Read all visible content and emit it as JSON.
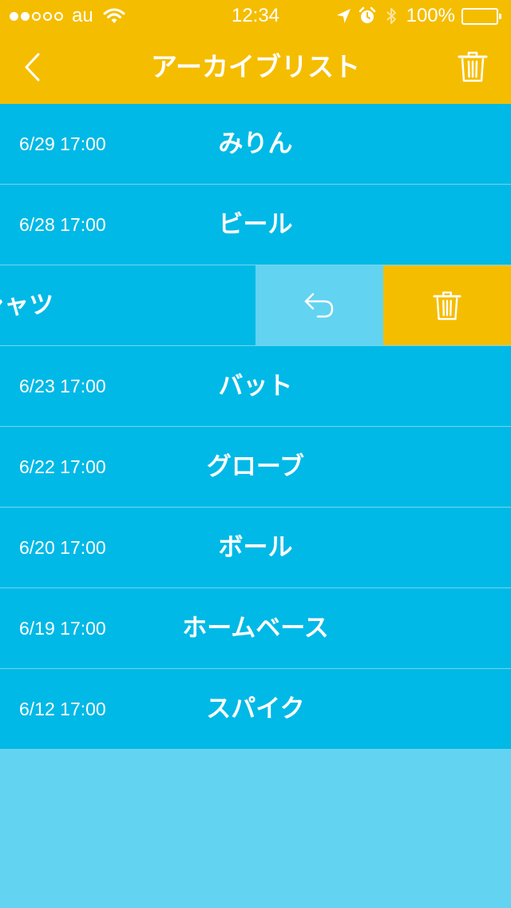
{
  "status": {
    "carrier": "au",
    "time": "12:34",
    "battery": "100%",
    "signal_filled": 2,
    "signal_total": 5
  },
  "navbar": {
    "title": "アーカイブリスト",
    "back_icon": "chevron-left-icon",
    "trash_icon": "trash-icon"
  },
  "items": [
    {
      "date": "6/29 17:00",
      "name": "みりん"
    },
    {
      "date": "6/28 17:00",
      "name": "ビール"
    },
    {
      "date": "",
      "name": "Tシャツ"
    },
    {
      "date": "6/23 17:00",
      "name": "バット"
    },
    {
      "date": "6/22 17:00",
      "name": "グローブ"
    },
    {
      "date": "6/20 17:00",
      "name": "ボール"
    },
    {
      "date": "6/19 17:00",
      "name": "ホームベース"
    },
    {
      "date": "6/12 17:00",
      "name": "スパイク"
    }
  ],
  "swipe_actions": {
    "restore_icon": "undo-icon",
    "delete_icon": "trash-icon"
  },
  "colors": {
    "accent": "#f5bd00",
    "row": "#00b9e6",
    "background": "#62d3f0"
  }
}
